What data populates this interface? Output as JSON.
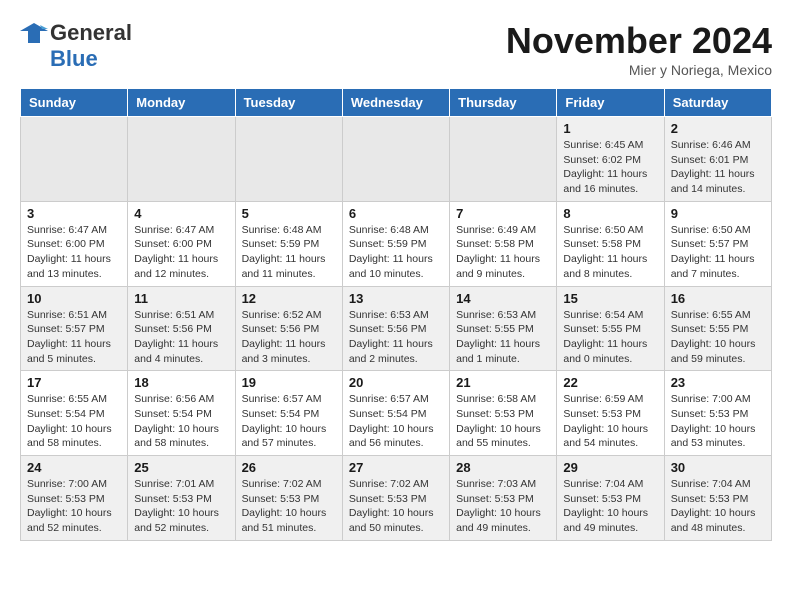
{
  "header": {
    "logo_general": "General",
    "logo_blue": "Blue",
    "month_title": "November 2024",
    "location": "Mier y Noriega, Mexico"
  },
  "weekdays": [
    "Sunday",
    "Monday",
    "Tuesday",
    "Wednesday",
    "Thursday",
    "Friday",
    "Saturday"
  ],
  "weeks": [
    [
      {
        "day": "",
        "detail": ""
      },
      {
        "day": "",
        "detail": ""
      },
      {
        "day": "",
        "detail": ""
      },
      {
        "day": "",
        "detail": ""
      },
      {
        "day": "",
        "detail": ""
      },
      {
        "day": "1",
        "detail": "Sunrise: 6:45 AM\nSunset: 6:02 PM\nDaylight: 11 hours\nand 16 minutes."
      },
      {
        "day": "2",
        "detail": "Sunrise: 6:46 AM\nSunset: 6:01 PM\nDaylight: 11 hours\nand 14 minutes."
      }
    ],
    [
      {
        "day": "3",
        "detail": "Sunrise: 6:47 AM\nSunset: 6:00 PM\nDaylight: 11 hours\nand 13 minutes."
      },
      {
        "day": "4",
        "detail": "Sunrise: 6:47 AM\nSunset: 6:00 PM\nDaylight: 11 hours\nand 12 minutes."
      },
      {
        "day": "5",
        "detail": "Sunrise: 6:48 AM\nSunset: 5:59 PM\nDaylight: 11 hours\nand 11 minutes."
      },
      {
        "day": "6",
        "detail": "Sunrise: 6:48 AM\nSunset: 5:59 PM\nDaylight: 11 hours\nand 10 minutes."
      },
      {
        "day": "7",
        "detail": "Sunrise: 6:49 AM\nSunset: 5:58 PM\nDaylight: 11 hours\nand 9 minutes."
      },
      {
        "day": "8",
        "detail": "Sunrise: 6:50 AM\nSunset: 5:58 PM\nDaylight: 11 hours\nand 8 minutes."
      },
      {
        "day": "9",
        "detail": "Sunrise: 6:50 AM\nSunset: 5:57 PM\nDaylight: 11 hours\nand 7 minutes."
      }
    ],
    [
      {
        "day": "10",
        "detail": "Sunrise: 6:51 AM\nSunset: 5:57 PM\nDaylight: 11 hours\nand 5 minutes."
      },
      {
        "day": "11",
        "detail": "Sunrise: 6:51 AM\nSunset: 5:56 PM\nDaylight: 11 hours\nand 4 minutes."
      },
      {
        "day": "12",
        "detail": "Sunrise: 6:52 AM\nSunset: 5:56 PM\nDaylight: 11 hours\nand 3 minutes."
      },
      {
        "day": "13",
        "detail": "Sunrise: 6:53 AM\nSunset: 5:56 PM\nDaylight: 11 hours\nand 2 minutes."
      },
      {
        "day": "14",
        "detail": "Sunrise: 6:53 AM\nSunset: 5:55 PM\nDaylight: 11 hours\nand 1 minute."
      },
      {
        "day": "15",
        "detail": "Sunrise: 6:54 AM\nSunset: 5:55 PM\nDaylight: 11 hours\nand 0 minutes."
      },
      {
        "day": "16",
        "detail": "Sunrise: 6:55 AM\nSunset: 5:55 PM\nDaylight: 10 hours\nand 59 minutes."
      }
    ],
    [
      {
        "day": "17",
        "detail": "Sunrise: 6:55 AM\nSunset: 5:54 PM\nDaylight: 10 hours\nand 58 minutes."
      },
      {
        "day": "18",
        "detail": "Sunrise: 6:56 AM\nSunset: 5:54 PM\nDaylight: 10 hours\nand 58 minutes."
      },
      {
        "day": "19",
        "detail": "Sunrise: 6:57 AM\nSunset: 5:54 PM\nDaylight: 10 hours\nand 57 minutes."
      },
      {
        "day": "20",
        "detail": "Sunrise: 6:57 AM\nSunset: 5:54 PM\nDaylight: 10 hours\nand 56 minutes."
      },
      {
        "day": "21",
        "detail": "Sunrise: 6:58 AM\nSunset: 5:53 PM\nDaylight: 10 hours\nand 55 minutes."
      },
      {
        "day": "22",
        "detail": "Sunrise: 6:59 AM\nSunset: 5:53 PM\nDaylight: 10 hours\nand 54 minutes."
      },
      {
        "day": "23",
        "detail": "Sunrise: 7:00 AM\nSunset: 5:53 PM\nDaylight: 10 hours\nand 53 minutes."
      }
    ],
    [
      {
        "day": "24",
        "detail": "Sunrise: 7:00 AM\nSunset: 5:53 PM\nDaylight: 10 hours\nand 52 minutes."
      },
      {
        "day": "25",
        "detail": "Sunrise: 7:01 AM\nSunset: 5:53 PM\nDaylight: 10 hours\nand 52 minutes."
      },
      {
        "day": "26",
        "detail": "Sunrise: 7:02 AM\nSunset: 5:53 PM\nDaylight: 10 hours\nand 51 minutes."
      },
      {
        "day": "27",
        "detail": "Sunrise: 7:02 AM\nSunset: 5:53 PM\nDaylight: 10 hours\nand 50 minutes."
      },
      {
        "day": "28",
        "detail": "Sunrise: 7:03 AM\nSunset: 5:53 PM\nDaylight: 10 hours\nand 49 minutes."
      },
      {
        "day": "29",
        "detail": "Sunrise: 7:04 AM\nSunset: 5:53 PM\nDaylight: 10 hours\nand 49 minutes."
      },
      {
        "day": "30",
        "detail": "Sunrise: 7:04 AM\nSunset: 5:53 PM\nDaylight: 10 hours\nand 48 minutes."
      }
    ]
  ]
}
